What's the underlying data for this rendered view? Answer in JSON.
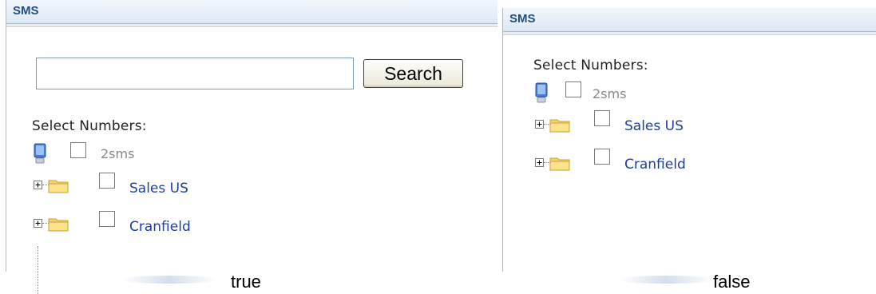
{
  "left_panel": {
    "header": "SMS",
    "search": {
      "value": "",
      "placeholder": "",
      "button_label": "Search"
    },
    "select_label": "Select Numbers:",
    "root": {
      "label": "2sms",
      "icon": "computer-icon"
    },
    "nodes": [
      {
        "label": "Sales US",
        "icon": "folder-icon"
      },
      {
        "label": "Cranfield",
        "icon": "folder-icon"
      }
    ],
    "caption": "true"
  },
  "right_panel": {
    "header": "SMS",
    "select_label": "Select Numbers:",
    "root": {
      "label": "2sms",
      "icon": "computer-icon"
    },
    "nodes": [
      {
        "label": "Sales US",
        "icon": "folder-icon"
      },
      {
        "label": "Cranfield",
        "icon": "folder-icon"
      }
    ],
    "caption": "false"
  },
  "colors": {
    "header_text": "#1f4e86",
    "node_link": "#1f3f9f",
    "root_text": "#888888"
  }
}
